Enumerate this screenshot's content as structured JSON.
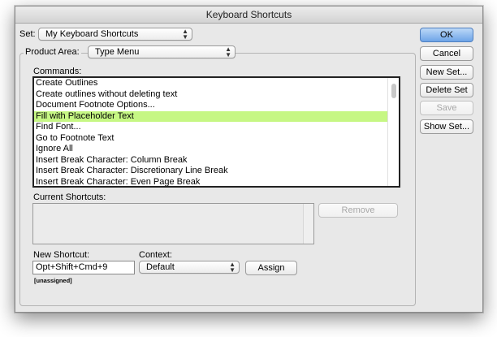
{
  "window": {
    "title": "Keyboard Shortcuts"
  },
  "set": {
    "label": "Set:",
    "value": "My Keyboard Shortcuts"
  },
  "product_area": {
    "label": "Product Area:",
    "value": "Type Menu"
  },
  "commands": {
    "label": "Commands:",
    "items": [
      {
        "label": "Create Outlines"
      },
      {
        "label": "Create outlines without deleting text"
      },
      {
        "label": "Document Footnote Options..."
      },
      {
        "label": "Fill with Placeholder Text"
      },
      {
        "label": "Find Font..."
      },
      {
        "label": "Go to Footnote Text"
      },
      {
        "label": "Ignore All"
      },
      {
        "label": "Insert Break Character: Column Break"
      },
      {
        "label": "Insert Break Character: Discretionary Line Break"
      },
      {
        "label": "Insert Break Character: Even Page Break"
      }
    ],
    "selected_index": 3
  },
  "current_shortcuts": {
    "label": "Current Shortcuts:"
  },
  "remove_button": "Remove",
  "new_shortcut": {
    "label": "New Shortcut:",
    "value": "Opt+Shift+Cmd+9",
    "status": "[unassigned]"
  },
  "context": {
    "label": "Context:",
    "value": "Default"
  },
  "assign_button": "Assign",
  "buttons": {
    "ok": "OK",
    "cancel": "Cancel",
    "new_set": "New Set...",
    "delete_set": "Delete Set",
    "save": "Save",
    "show_set": "Show Set..."
  },
  "colors": {
    "selected_row": "#c6f784",
    "default_button": "#6ea4e8"
  },
  "icons": {
    "popup": "updown-arrows-icon"
  }
}
